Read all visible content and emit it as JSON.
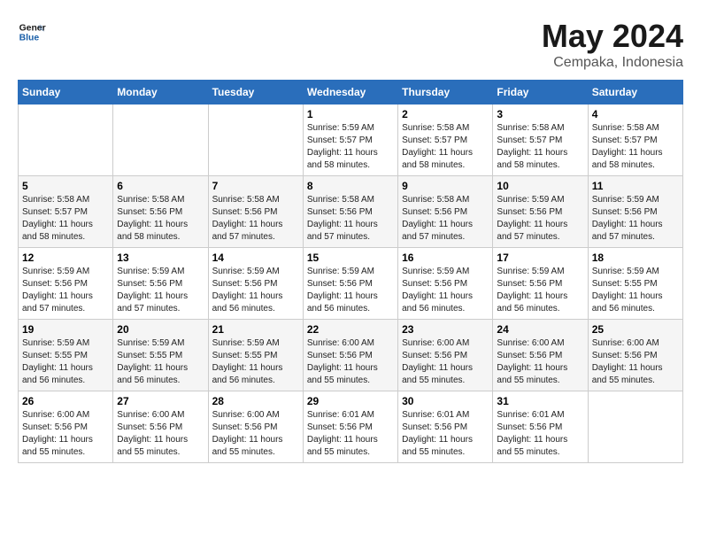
{
  "header": {
    "logo_general": "General",
    "logo_blue": "Blue",
    "main_title": "May 2024",
    "subtitle": "Cempaka, Indonesia"
  },
  "days_of_week": [
    "Sunday",
    "Monday",
    "Tuesday",
    "Wednesday",
    "Thursday",
    "Friday",
    "Saturday"
  ],
  "weeks": [
    [
      {
        "day": "",
        "info": ""
      },
      {
        "day": "",
        "info": ""
      },
      {
        "day": "",
        "info": ""
      },
      {
        "day": "1",
        "info": "Sunrise: 5:59 AM\nSunset: 5:57 PM\nDaylight: 11 hours and 58 minutes."
      },
      {
        "day": "2",
        "info": "Sunrise: 5:58 AM\nSunset: 5:57 PM\nDaylight: 11 hours and 58 minutes."
      },
      {
        "day": "3",
        "info": "Sunrise: 5:58 AM\nSunset: 5:57 PM\nDaylight: 11 hours and 58 minutes."
      },
      {
        "day": "4",
        "info": "Sunrise: 5:58 AM\nSunset: 5:57 PM\nDaylight: 11 hours and 58 minutes."
      }
    ],
    [
      {
        "day": "5",
        "info": "Sunrise: 5:58 AM\nSunset: 5:57 PM\nDaylight: 11 hours and 58 minutes."
      },
      {
        "day": "6",
        "info": "Sunrise: 5:58 AM\nSunset: 5:56 PM\nDaylight: 11 hours and 58 minutes."
      },
      {
        "day": "7",
        "info": "Sunrise: 5:58 AM\nSunset: 5:56 PM\nDaylight: 11 hours and 57 minutes."
      },
      {
        "day": "8",
        "info": "Sunrise: 5:58 AM\nSunset: 5:56 PM\nDaylight: 11 hours and 57 minutes."
      },
      {
        "day": "9",
        "info": "Sunrise: 5:58 AM\nSunset: 5:56 PM\nDaylight: 11 hours and 57 minutes."
      },
      {
        "day": "10",
        "info": "Sunrise: 5:59 AM\nSunset: 5:56 PM\nDaylight: 11 hours and 57 minutes."
      },
      {
        "day": "11",
        "info": "Sunrise: 5:59 AM\nSunset: 5:56 PM\nDaylight: 11 hours and 57 minutes."
      }
    ],
    [
      {
        "day": "12",
        "info": "Sunrise: 5:59 AM\nSunset: 5:56 PM\nDaylight: 11 hours and 57 minutes."
      },
      {
        "day": "13",
        "info": "Sunrise: 5:59 AM\nSunset: 5:56 PM\nDaylight: 11 hours and 57 minutes."
      },
      {
        "day": "14",
        "info": "Sunrise: 5:59 AM\nSunset: 5:56 PM\nDaylight: 11 hours and 56 minutes."
      },
      {
        "day": "15",
        "info": "Sunrise: 5:59 AM\nSunset: 5:56 PM\nDaylight: 11 hours and 56 minutes."
      },
      {
        "day": "16",
        "info": "Sunrise: 5:59 AM\nSunset: 5:56 PM\nDaylight: 11 hours and 56 minutes."
      },
      {
        "day": "17",
        "info": "Sunrise: 5:59 AM\nSunset: 5:56 PM\nDaylight: 11 hours and 56 minutes."
      },
      {
        "day": "18",
        "info": "Sunrise: 5:59 AM\nSunset: 5:55 PM\nDaylight: 11 hours and 56 minutes."
      }
    ],
    [
      {
        "day": "19",
        "info": "Sunrise: 5:59 AM\nSunset: 5:55 PM\nDaylight: 11 hours and 56 minutes."
      },
      {
        "day": "20",
        "info": "Sunrise: 5:59 AM\nSunset: 5:55 PM\nDaylight: 11 hours and 56 minutes."
      },
      {
        "day": "21",
        "info": "Sunrise: 5:59 AM\nSunset: 5:55 PM\nDaylight: 11 hours and 56 minutes."
      },
      {
        "day": "22",
        "info": "Sunrise: 6:00 AM\nSunset: 5:56 PM\nDaylight: 11 hours and 55 minutes."
      },
      {
        "day": "23",
        "info": "Sunrise: 6:00 AM\nSunset: 5:56 PM\nDaylight: 11 hours and 55 minutes."
      },
      {
        "day": "24",
        "info": "Sunrise: 6:00 AM\nSunset: 5:56 PM\nDaylight: 11 hours and 55 minutes."
      },
      {
        "day": "25",
        "info": "Sunrise: 6:00 AM\nSunset: 5:56 PM\nDaylight: 11 hours and 55 minutes."
      }
    ],
    [
      {
        "day": "26",
        "info": "Sunrise: 6:00 AM\nSunset: 5:56 PM\nDaylight: 11 hours and 55 minutes."
      },
      {
        "day": "27",
        "info": "Sunrise: 6:00 AM\nSunset: 5:56 PM\nDaylight: 11 hours and 55 minutes."
      },
      {
        "day": "28",
        "info": "Sunrise: 6:00 AM\nSunset: 5:56 PM\nDaylight: 11 hours and 55 minutes."
      },
      {
        "day": "29",
        "info": "Sunrise: 6:01 AM\nSunset: 5:56 PM\nDaylight: 11 hours and 55 minutes."
      },
      {
        "day": "30",
        "info": "Sunrise: 6:01 AM\nSunset: 5:56 PM\nDaylight: 11 hours and 55 minutes."
      },
      {
        "day": "31",
        "info": "Sunrise: 6:01 AM\nSunset: 5:56 PM\nDaylight: 11 hours and 55 minutes."
      },
      {
        "day": "",
        "info": ""
      }
    ]
  ]
}
